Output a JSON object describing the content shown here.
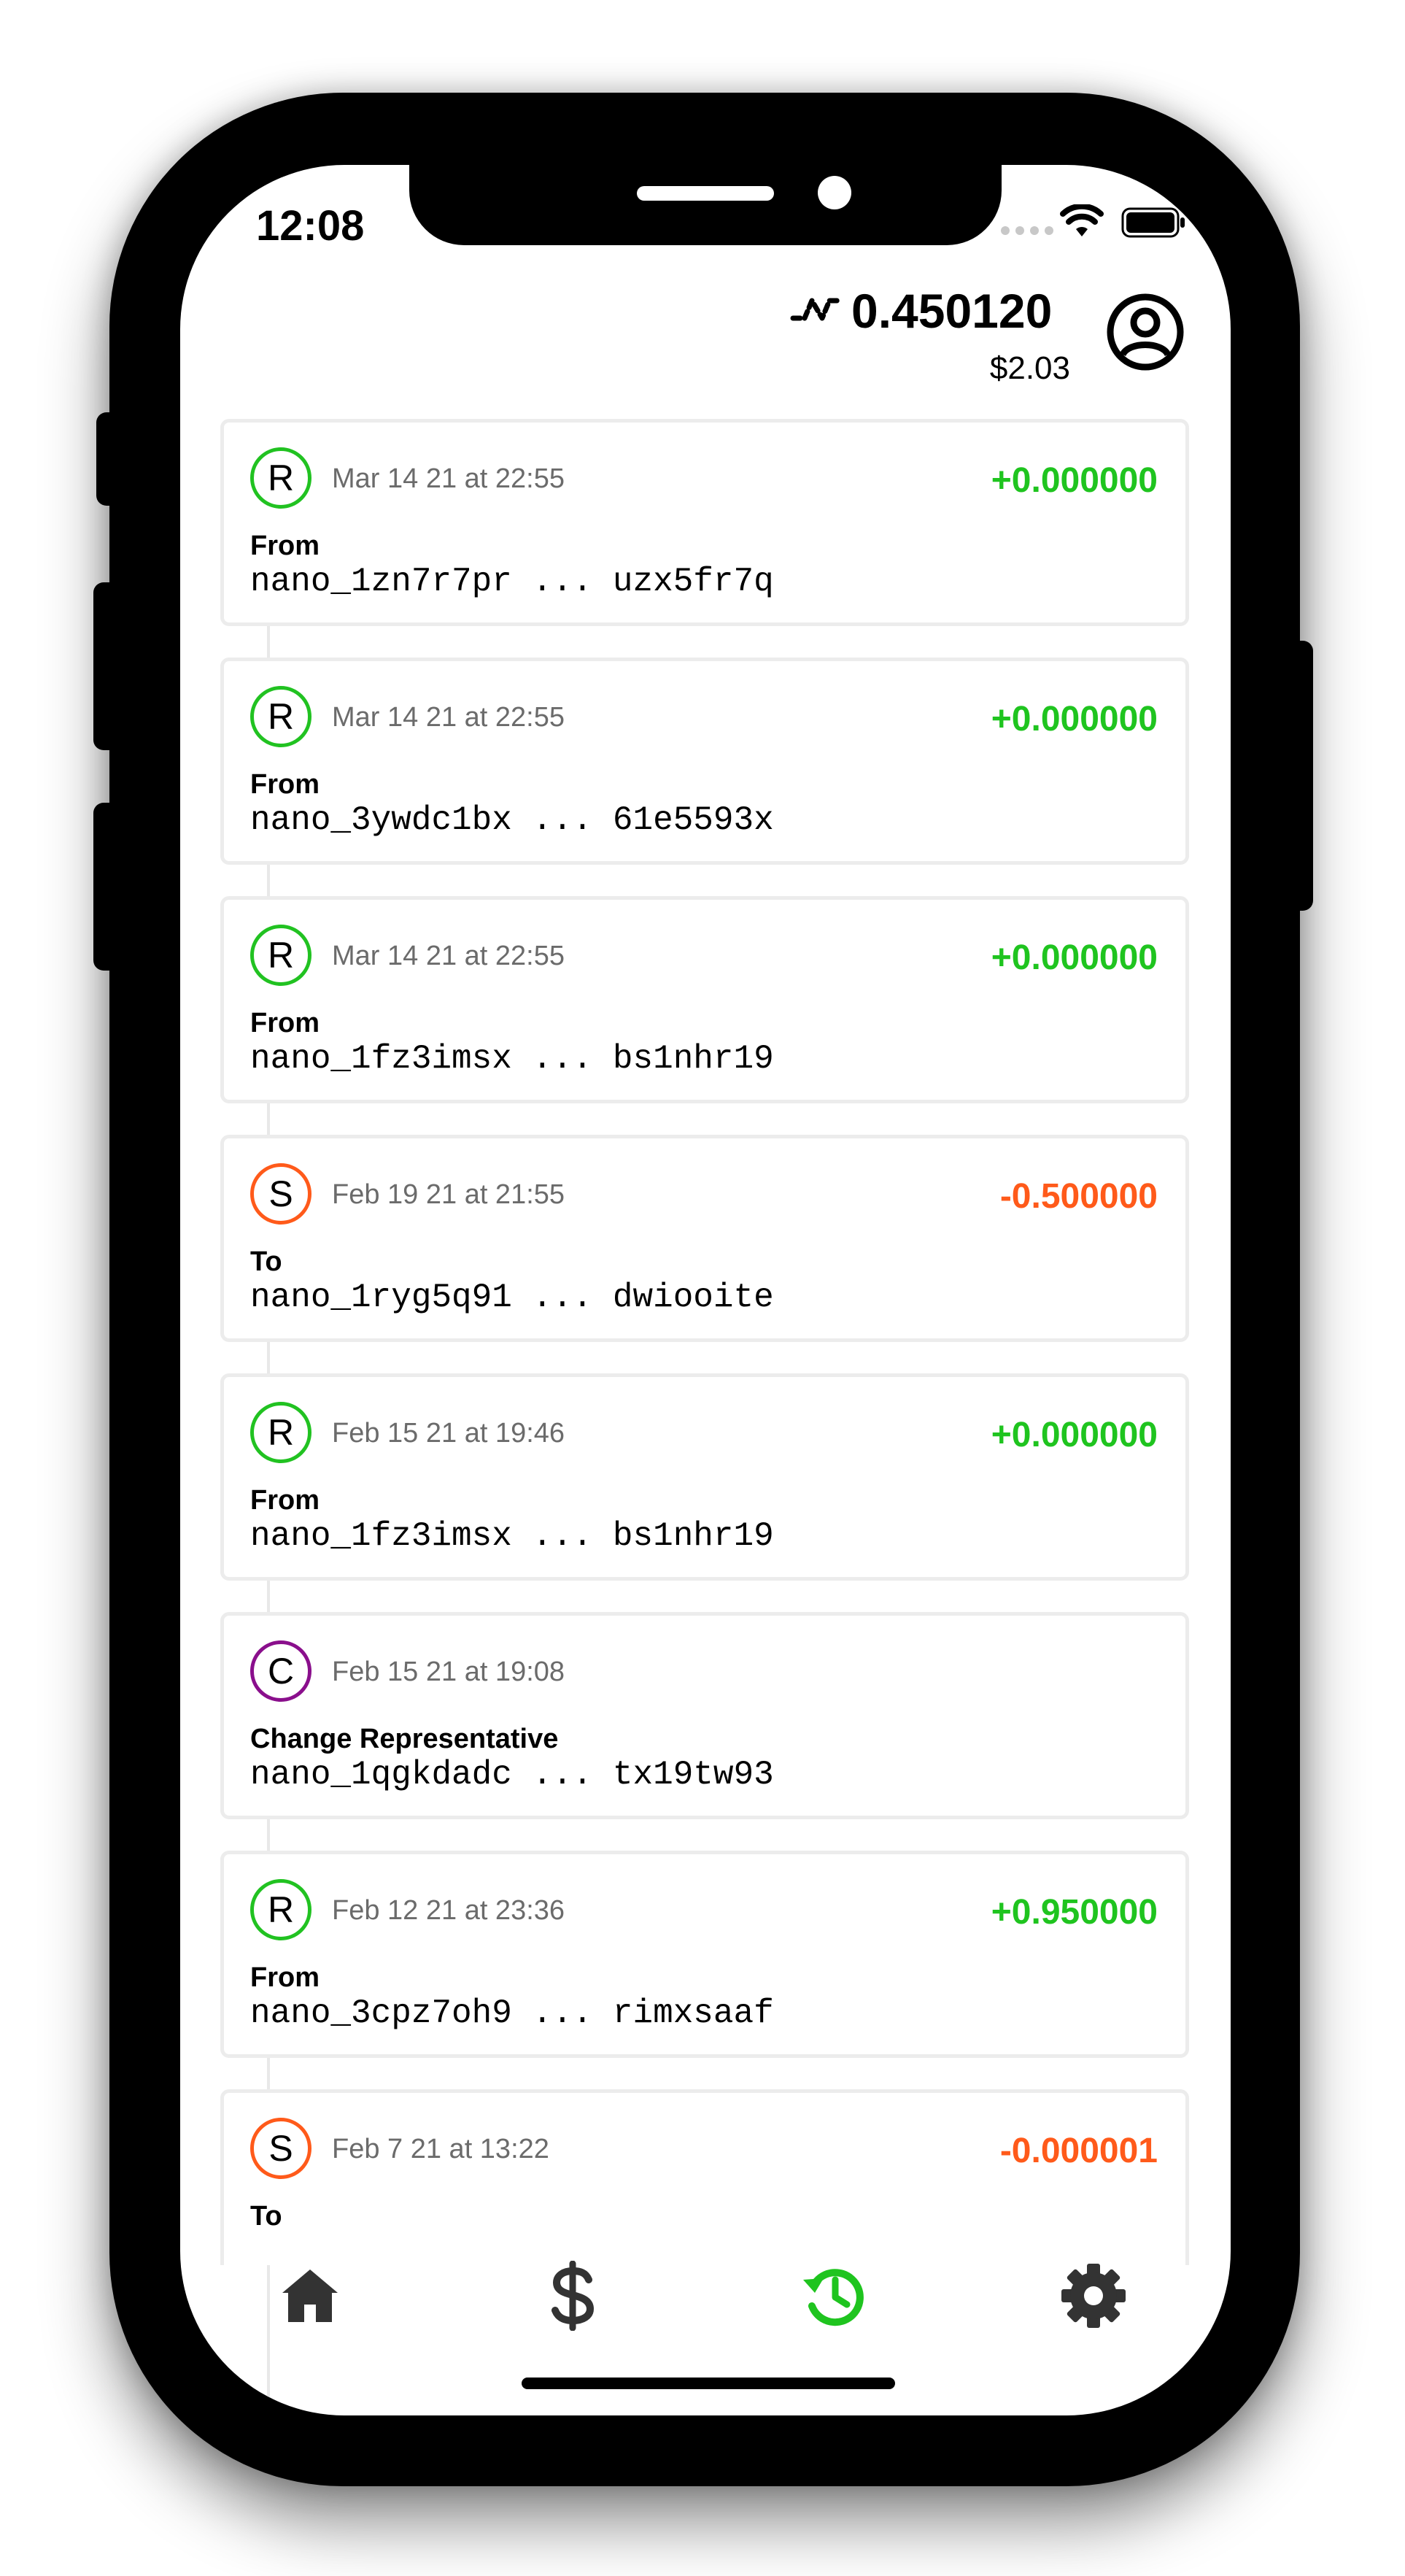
{
  "status_bar": {
    "time": "12:08"
  },
  "header": {
    "balance": "0.450120",
    "fiat": "$2.03"
  },
  "transactions": [
    {
      "type": "receive",
      "letter": "R",
      "date": "Mar 14 21 at 22:55",
      "amount": "+0.000000",
      "label": "From",
      "address": "nano_1zn7r7pr ... uzx5fr7q"
    },
    {
      "type": "receive",
      "letter": "R",
      "date": "Mar 14 21 at 22:55",
      "amount": "+0.000000",
      "label": "From",
      "address": "nano_3ywdc1bx ... 61e5593x"
    },
    {
      "type": "receive",
      "letter": "R",
      "date": "Mar 14 21 at 22:55",
      "amount": "+0.000000",
      "label": "From",
      "address": "nano_1fz3imsx ... bs1nhr19"
    },
    {
      "type": "send",
      "letter": "S",
      "date": "Feb 19 21 at 21:55",
      "amount": "-0.500000",
      "label": "To",
      "address": "nano_1ryg5q91 ... dwiooite"
    },
    {
      "type": "receive",
      "letter": "R",
      "date": "Feb 15 21 at 19:46",
      "amount": "+0.000000",
      "label": "From",
      "address": "nano_1fz3imsx ... bs1nhr19"
    },
    {
      "type": "change",
      "letter": "C",
      "date": "Feb 15 21 at 19:08",
      "amount": "",
      "label": "Change Representative",
      "address": "nano_1qgkdadc ... tx19tw93"
    },
    {
      "type": "receive",
      "letter": "R",
      "date": "Feb 12 21 at 23:36",
      "amount": "+0.950000",
      "label": "From",
      "address": "nano_3cpz7oh9 ... rimxsaaf"
    },
    {
      "type": "send",
      "letter": "S",
      "date": "Feb 7 21 at 13:22",
      "amount": "-0.000001",
      "label": "To",
      "address": ""
    }
  ],
  "tabs": [
    {
      "icon": "home-icon",
      "active": false
    },
    {
      "icon": "dollar-icon",
      "active": false
    },
    {
      "icon": "history-icon",
      "active": true
    },
    {
      "icon": "gear-icon",
      "active": false
    }
  ],
  "colors": {
    "receive": "#1fc41f",
    "send": "#ff5a1a",
    "change": "#8a0f8c",
    "active_tab": "#1fc41f",
    "inactive_tab": "#333333"
  }
}
